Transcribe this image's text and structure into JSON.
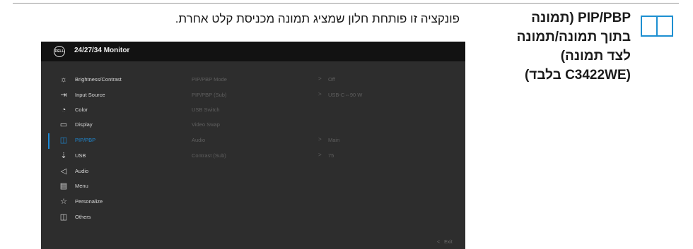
{
  "heading": {
    "line1": "PIP/PBP (תמונה",
    "line2": "בתוך תמונה/תמונה",
    "line3": "לצד תמונה)",
    "line4": "(C3422WE בלבד)"
  },
  "description": "פונקציה זו פותחת חלון שמציג תמונה מכניסת קלט אחרת.",
  "osd": {
    "title": "24/27/34 Monitor",
    "logo_text": "DELL",
    "menu": [
      {
        "label": "Brightness/Contrast",
        "icon": "☼",
        "icon_name": "brightness-icon"
      },
      {
        "label": "Input Source",
        "icon": "⇥",
        "icon_name": "input-source-icon"
      },
      {
        "label": "Color",
        "icon": "◔",
        "icon_name": "color-icon"
      },
      {
        "label": "Display",
        "icon": "▭",
        "icon_name": "display-icon"
      },
      {
        "label": "PIP/PBP",
        "icon": "◫",
        "icon_name": "pip-pbp-icon"
      },
      {
        "label": "USB",
        "icon": "⇣",
        "icon_name": "usb-icon"
      },
      {
        "label": "Audio",
        "icon": "◁",
        "icon_name": "audio-icon"
      },
      {
        "label": "Menu",
        "icon": "▤",
        "icon_name": "menu-icon"
      },
      {
        "label": "Personalize",
        "icon": "☆",
        "icon_name": "personalize-icon"
      },
      {
        "label": "Others",
        "icon": "◫",
        "icon_name": "others-icon"
      }
    ],
    "active_index": 4,
    "submenu": [
      {
        "label": "PIP/PBP Mode",
        "arrow": ">",
        "value": "Off"
      },
      {
        "label": "PIP/PBP (Sub)",
        "arrow": ">",
        "value": "USB-C⇔90 W"
      },
      {
        "label": "USB Switch",
        "arrow": "",
        "value": ""
      },
      {
        "label": "Video Swap",
        "arrow": "",
        "value": ""
      },
      {
        "label": "Audio",
        "arrow": ">",
        "value": "Main"
      },
      {
        "label": "Contrast (Sub)",
        "arrow": ">",
        "value": "75"
      }
    ],
    "exit_label": "Exit",
    "exit_chevron": "<"
  },
  "colors": {
    "accent": "#1e8ad6",
    "osd_background": "#2d2d2d",
    "osd_header": "#121212",
    "icon_blue": "#1d8fd1"
  }
}
